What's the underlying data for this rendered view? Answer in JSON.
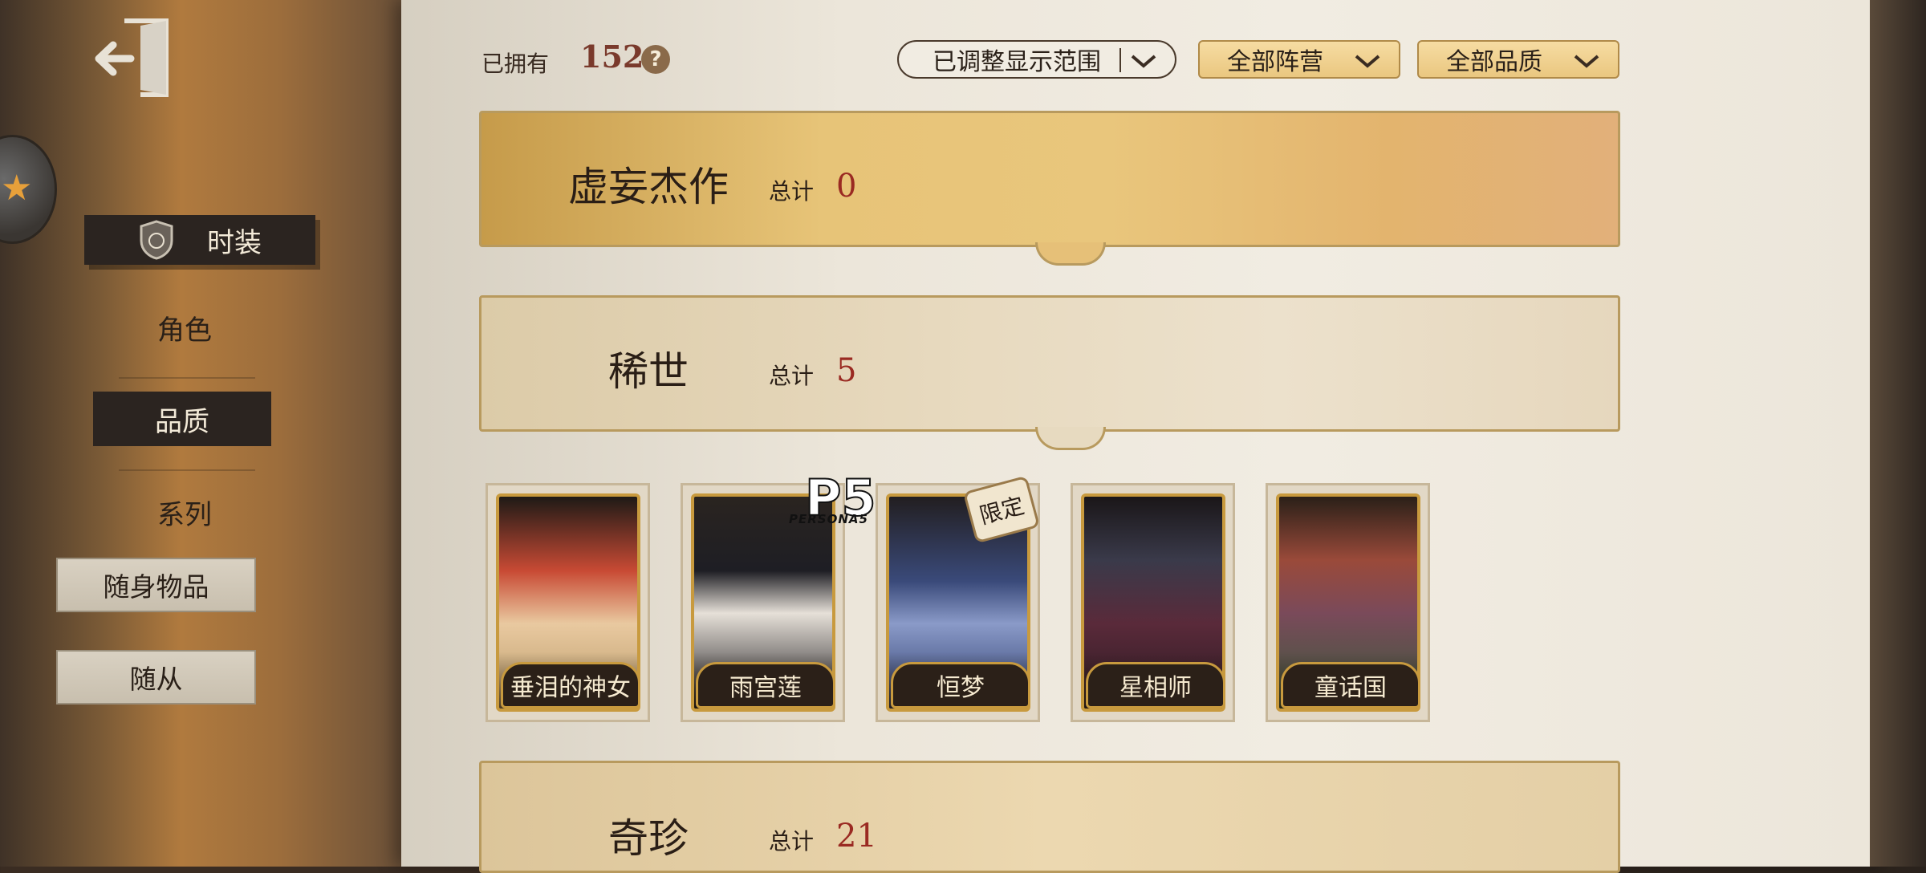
{
  "sidebar": {
    "tabs": [
      {
        "label": "时装"
      },
      {
        "label": "角色"
      },
      {
        "label": "品质"
      },
      {
        "label": "系列"
      }
    ],
    "boxed": [
      {
        "label": "随身物品"
      },
      {
        "label": "随从"
      }
    ]
  },
  "header": {
    "owned_label": "已拥有",
    "owned_count": "152",
    "help": "?",
    "filters": {
      "range": "已调整显示范围",
      "camp": "全部阵营",
      "quality": "全部品质"
    }
  },
  "sections": [
    {
      "name": "虚妄杰作",
      "total_label": "总计",
      "total": "0"
    },
    {
      "name": "稀世",
      "total_label": "总计",
      "total": "5"
    },
    {
      "name": "奇珍",
      "total_label": "总计",
      "total": "21"
    }
  ],
  "cards": [
    {
      "name": "垂泪的神女",
      "color": "#c84a34"
    },
    {
      "name": "雨宫莲",
      "color": "#1e1e24"
    },
    {
      "name": "恒梦",
      "color": "#3a4a7a"
    },
    {
      "name": "星相师",
      "color": "#5a2a3a"
    },
    {
      "name": "童话国",
      "color": "#7a4a5a"
    }
  ],
  "card_badges": {
    "persona_logo_big": "P5",
    "persona_logo_small": "PERSONA5",
    "limited": "限定"
  },
  "colors": {
    "accent_red": "#9a2a22",
    "gold": "#c89a3e",
    "dark": "#2b2420"
  }
}
